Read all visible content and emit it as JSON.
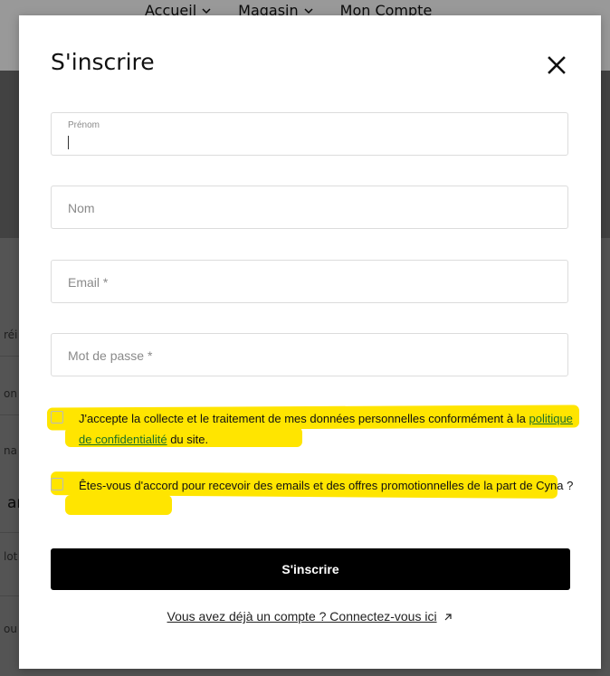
{
  "background": {
    "nav": [
      "Accueil",
      "Magasin",
      "Mon Compte"
    ],
    "fragments": [
      "réi",
      "on",
      "na",
      "ar",
      "lot",
      "ou"
    ]
  },
  "modal": {
    "title": "S'inscrire",
    "close_icon": "close-icon",
    "fields": {
      "first_name": {
        "label": "Prénom",
        "value": ""
      },
      "last_name": {
        "label": "Nom",
        "value": ""
      },
      "email": {
        "label": "Email *",
        "value": ""
      },
      "password": {
        "label": "Mot de passe *",
        "value": ""
      }
    },
    "consent_privacy": {
      "text_before": "J'accepte la collecte et le traitement de mes données personnelles conformément à la ",
      "link_text": "politique de confidentialité",
      "text_after": " du site."
    },
    "consent_marketing": {
      "text": "Êtes-vous d'accord pour recevoir des emails et des offres promotionnelles de la part de Cyna ?"
    },
    "submit_label": "S'inscrire",
    "login_link": "Vous avez déjà un compte ? Connectez-vous ici"
  },
  "colors": {
    "highlight": "#ffe500",
    "button": "#000000",
    "link": "#1c6f27"
  }
}
